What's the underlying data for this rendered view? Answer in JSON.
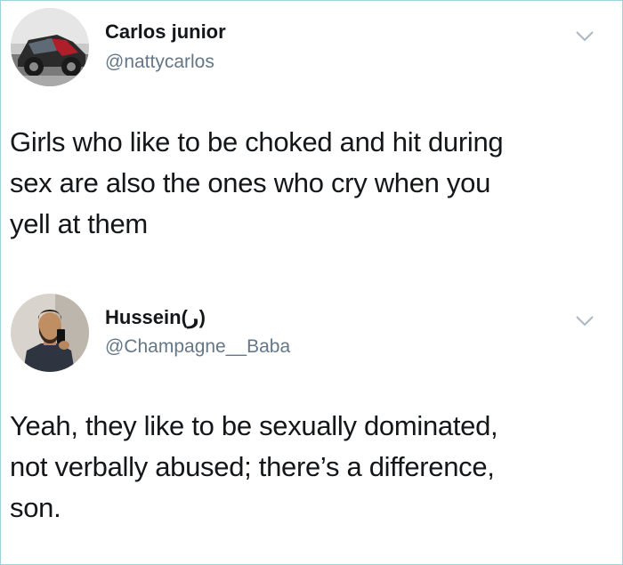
{
  "tweets": [
    {
      "author_name": "Carlos junior",
      "author_handle": "@nattycarlos",
      "avatar_icon": "profile-photo-car",
      "menu_icon": "chevron-down-icon",
      "text_lines": [
        "Girls who like to be choked and hit during",
        "sex are also the ones who cry when you",
        "yell at them"
      ]
    },
    {
      "author_name": "Hussein(ر)",
      "author_handle": "@Champagne__Baba",
      "avatar_icon": "profile-photo-person",
      "menu_icon": "chevron-down-icon",
      "text_lines": [
        "Yeah, they like to be sexually dominated,",
        "not verbally abused; there’s a difference,",
        "son."
      ]
    }
  ],
  "colors": {
    "text": "#14171a",
    "handle": "#657786",
    "chevron": "#aab8c2",
    "frame_border": "#9fd3dc"
  }
}
